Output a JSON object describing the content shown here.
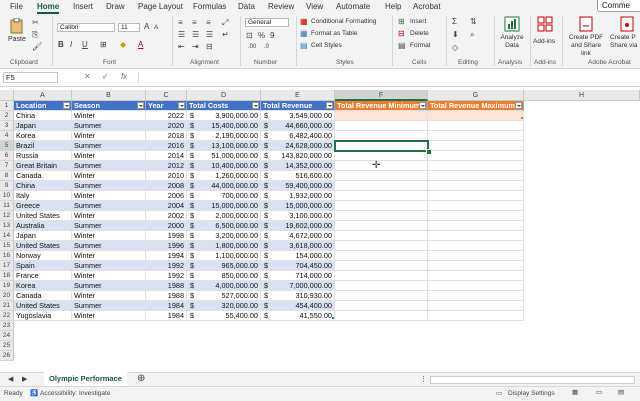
{
  "menu": {
    "items": [
      "File",
      "Home",
      "Insert",
      "Draw",
      "Page Layout",
      "Formulas",
      "Data",
      "Review",
      "View",
      "Automate",
      "Help",
      "Acrobat"
    ],
    "active": "Home",
    "comments_label": "Comme"
  },
  "ribbon": {
    "paste_label": "Paste",
    "font_name": "Calibri",
    "font_size": "11",
    "number_format": "General",
    "conditional_formatting": "Conditional Formatting",
    "format_as_table": "Format as Table",
    "cell_styles": "Cell Styles",
    "insert": "Insert",
    "delete": "Delete",
    "format": "Format",
    "analyze_data": "Analyze Data",
    "addins": "Add-ins",
    "create_pdf_link": "Create PDF and Share link",
    "create_pdf_share": "Create P Share via",
    "groups": {
      "clipboard": "Clipboard",
      "font": "Font",
      "alignment": "Alignment",
      "number": "Number",
      "styles": "Styles",
      "cells": "Cells",
      "editing": "Editing",
      "analysis": "Analysis",
      "addins": "Add-ins",
      "acrobat": "Adobe Acrobat"
    }
  },
  "formula_bar": {
    "name_box": "F5",
    "fx": "fx",
    "formula": ""
  },
  "grid": {
    "columns": [
      "A",
      "B",
      "C",
      "D",
      "E",
      "F",
      "G",
      "H"
    ],
    "selected_column": "F",
    "selected_row": "5",
    "headers": [
      "Location",
      "Season",
      "Year",
      "Total Costs",
      "Total Revenue",
      "Total Revenue Minimum",
      "Total Revenue Maximum"
    ],
    "currency_symbol": "$",
    "rows": [
      [
        "China",
        "Winter",
        "2022",
        "3,900,000.00",
        "3,549,000.00"
      ],
      [
        "Japan",
        "Summer",
        "2020",
        "15,400,000.00",
        "44,660,000.00"
      ],
      [
        "Korea",
        "Winter",
        "2018",
        "2,190,000.00",
        "6,482,400.00"
      ],
      [
        "Brazil",
        "Summer",
        "2016",
        "13,100,000.00",
        "24,628,000.00"
      ],
      [
        "Russia",
        "Winter",
        "2014",
        "51,000,000.00",
        "143,820,000.00"
      ],
      [
        "Great Britain",
        "Summer",
        "2012",
        "10,400,000.00",
        "14,352,000.00"
      ],
      [
        "Canada",
        "Winter",
        "2010",
        "1,260,000.00",
        "516,600.00"
      ],
      [
        "China",
        "Summer",
        "2008",
        "44,000,000.00",
        "59,400,000.00"
      ],
      [
        "Italy",
        "Winter",
        "2006",
        "700,000.00",
        "1,932,000.00"
      ],
      [
        "Greece",
        "Summer",
        "2004",
        "15,000,000.00",
        "15,000,000.00"
      ],
      [
        "United States",
        "Winter",
        "2002",
        "2,000,000.00",
        "3,100,000.00"
      ],
      [
        "Australia",
        "Summer",
        "2000",
        "6,500,000.00",
        "19,602,000.00"
      ],
      [
        "Japan",
        "Winter",
        "1998",
        "3,200,000.00",
        "4,672,000.00"
      ],
      [
        "United States",
        "Summer",
        "1996",
        "1,800,000.00",
        "3,618,000.00"
      ],
      [
        "Norway",
        "Winter",
        "1994",
        "1,100,000.00",
        "154,000.00"
      ],
      [
        "Spain",
        "Summer",
        "1992",
        "965,000.00",
        "704,450.00"
      ],
      [
        "France",
        "Winter",
        "1992",
        "850,000.00",
        "714,000.00"
      ],
      [
        "Korea",
        "Summer",
        "1988",
        "4,000,000.00",
        "7,000,000.00"
      ],
      [
        "Canada",
        "Winter",
        "1988",
        "527,000.00",
        "310,930.00"
      ],
      [
        "United States",
        "Summer",
        "1984",
        "320,000.00",
        "454,400.00"
      ],
      [
        "Yugoslavia",
        "Winter",
        "1984",
        "55,400.00",
        "41,550.00"
      ]
    ],
    "row_numbers": [
      "1",
      "2",
      "3",
      "4",
      "5",
      "6",
      "7",
      "8",
      "9",
      "10",
      "11",
      "12",
      "13",
      "14",
      "15",
      "16",
      "17",
      "18",
      "19",
      "20",
      "21",
      "22",
      "23",
      "24",
      "25",
      "26"
    ]
  },
  "sheets": {
    "active": "Olympic Performace"
  },
  "status": {
    "ready": "Ready",
    "accessibility": "Accessibility: Investigate",
    "display_settings": "Display Settings"
  },
  "colors": {
    "header_blue": "#4472c4",
    "header_orange": "#ed7d31",
    "band": "#d9e1f2",
    "excel_green": "#217346"
  }
}
